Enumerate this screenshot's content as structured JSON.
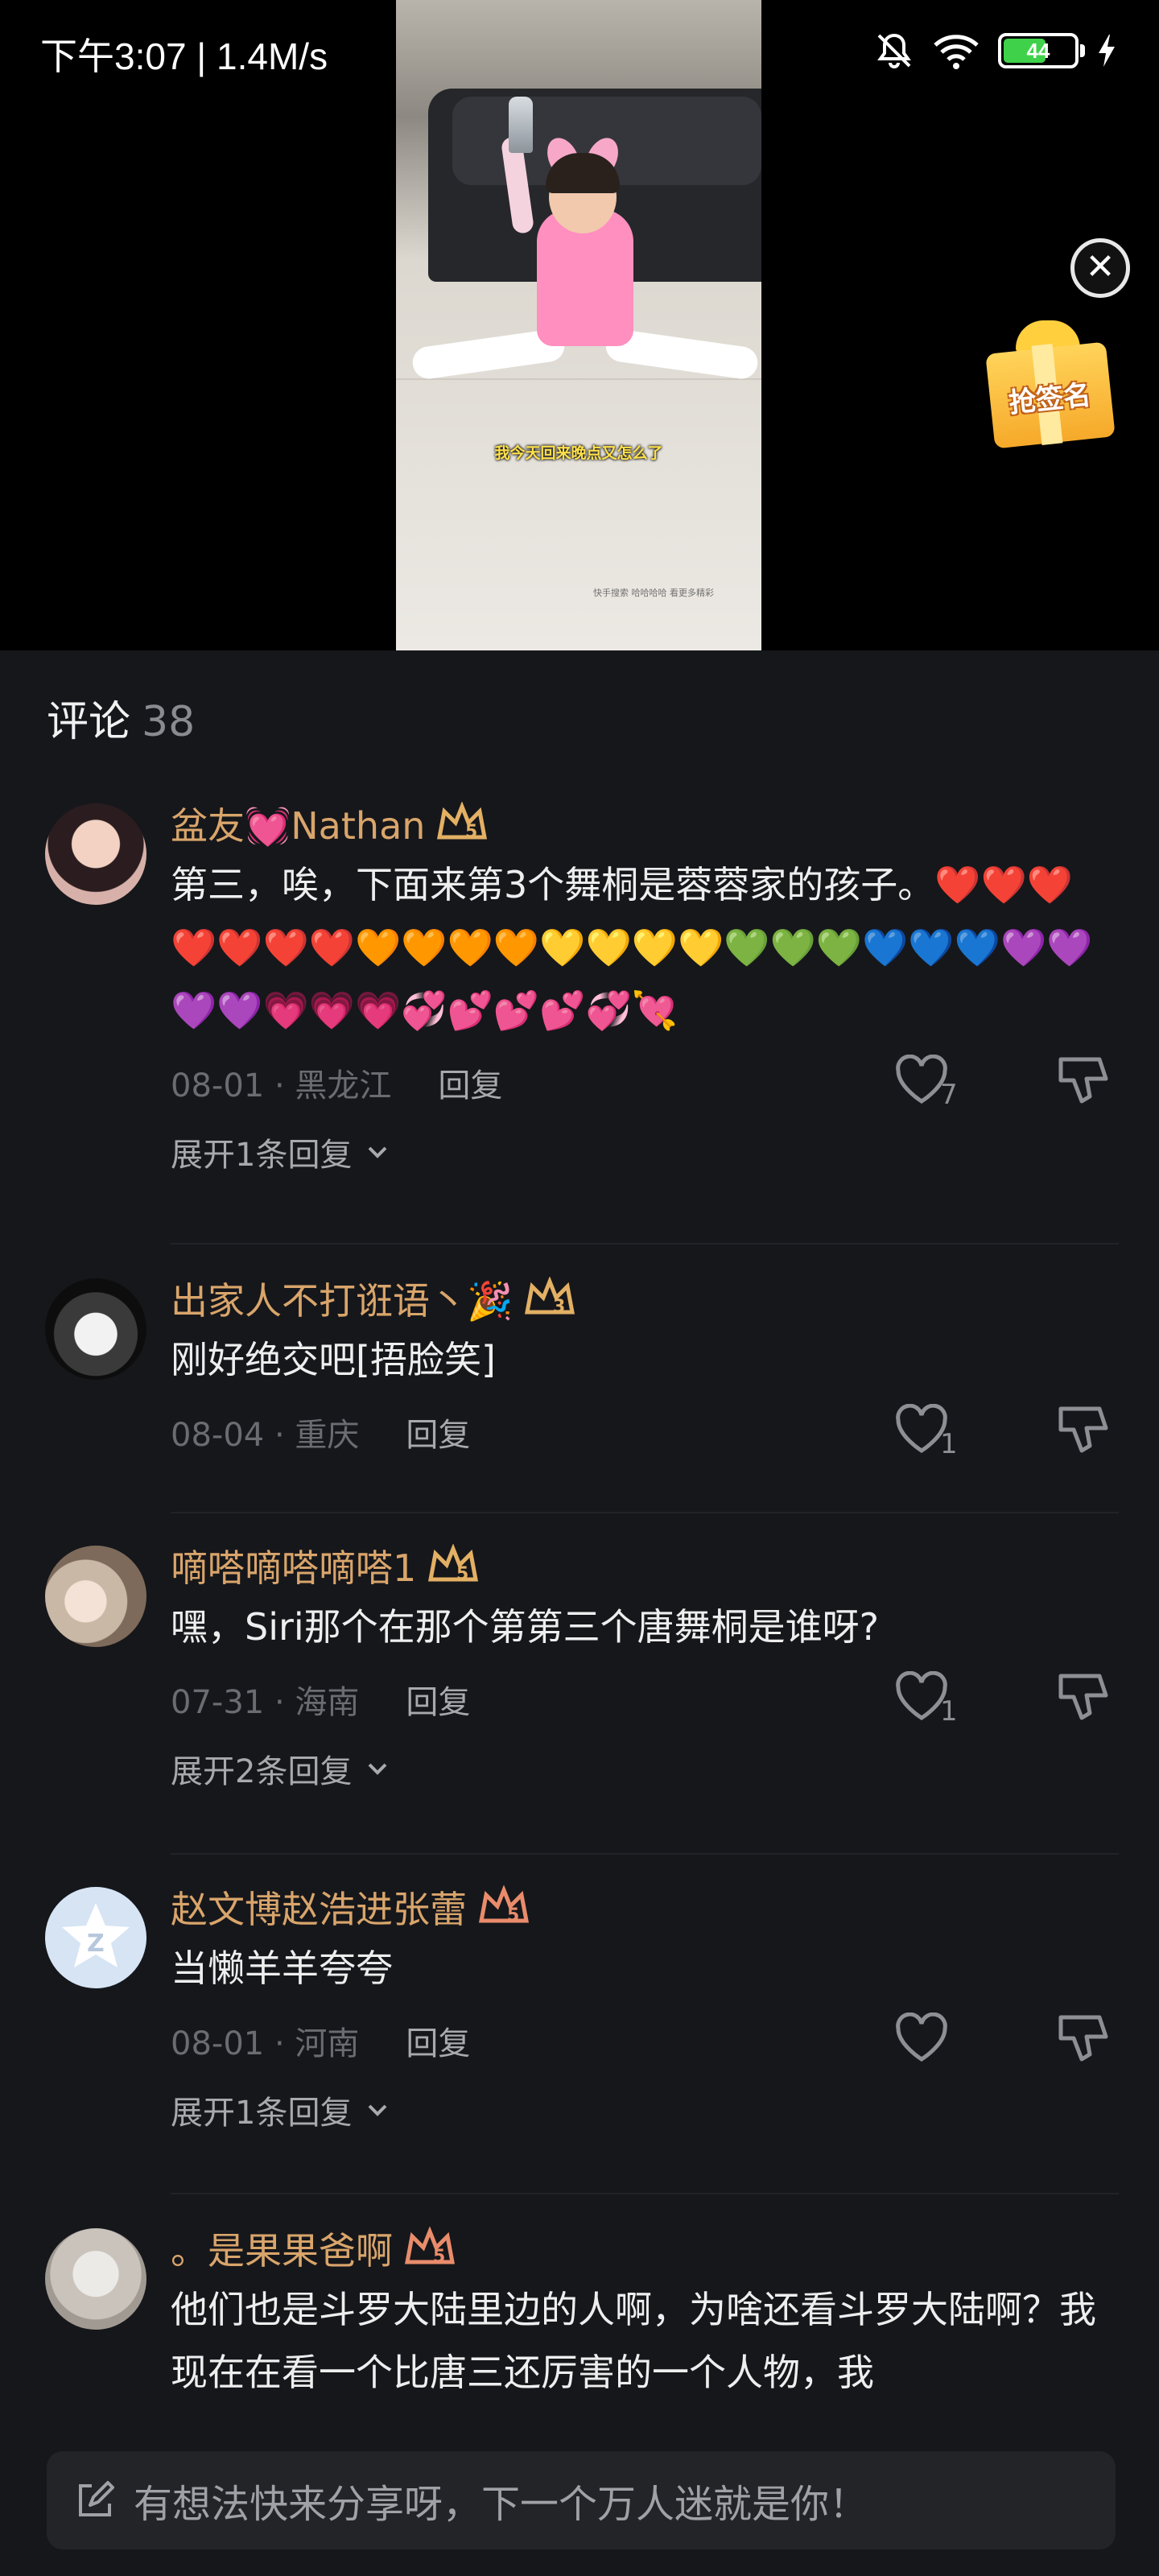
{
  "status_bar": {
    "time": "下午3:07 | 1.4M/s",
    "battery": "44",
    "icons": [
      "bell-muted-icon",
      "wifi-icon",
      "battery-icon",
      "charging-icon"
    ]
  },
  "video": {
    "subtitle": "我今天回来晚点又怎么了",
    "watermark": "快手搜索 哈哈哈哈 看更多精彩",
    "gift_label": "抢签名"
  },
  "comments_header": {
    "title": "评论",
    "count": "38"
  },
  "comments": [
    {
      "username": "盆友💓Nathan",
      "text": "第三，唉，下面来第3个舞桐是蓉蓉家的孩子。❤️❤️❤️❤️❤️❤️❤️🧡🧡🧡🧡💛💛💛💛💚💚💚💙💙💙💜💜💜💜💗💗💗💞💕💕💕💞💘",
      "date": "08-01 · 黑龙江",
      "reply": "回复",
      "likes": "7",
      "expand": "展开1条回复"
    },
    {
      "username": "出家人不打诳语丶🎉",
      "text": "刚好绝交吧[捂脸笑]",
      "date": "08-04 · 重庆",
      "reply": "回复",
      "likes": "1",
      "expand": ""
    },
    {
      "username": "嘀嗒嘀嗒嘀嗒1",
      "text": "嘿，Siri那个在那个第第三个唐舞桐是谁呀?",
      "date": "07-31 · 海南",
      "reply": "回复",
      "likes": "1",
      "expand": "展开2条回复"
    },
    {
      "username": "赵文博赵浩进张蕾",
      "text": "当懒羊羊夸夸",
      "date": "08-01 · 河南",
      "reply": "回复",
      "likes": "",
      "expand": "展开1条回复"
    },
    {
      "username": "。是果果爸啊",
      "text": "他们也是斗罗大陆里边的人啊，为啥还看斗罗大陆啊？我现在在看一个比唐三还厉害的一个人物，我",
      "date": "",
      "reply": "",
      "likes": "",
      "expand": ""
    }
  ],
  "input_bar": {
    "placeholder": "有想法快来分享呀，下一个万人迷就是你！"
  },
  "colors": {
    "background": "#16171b",
    "username": "#d9a56b",
    "meta": "#6b6c71",
    "input_bg": "#232428"
  }
}
